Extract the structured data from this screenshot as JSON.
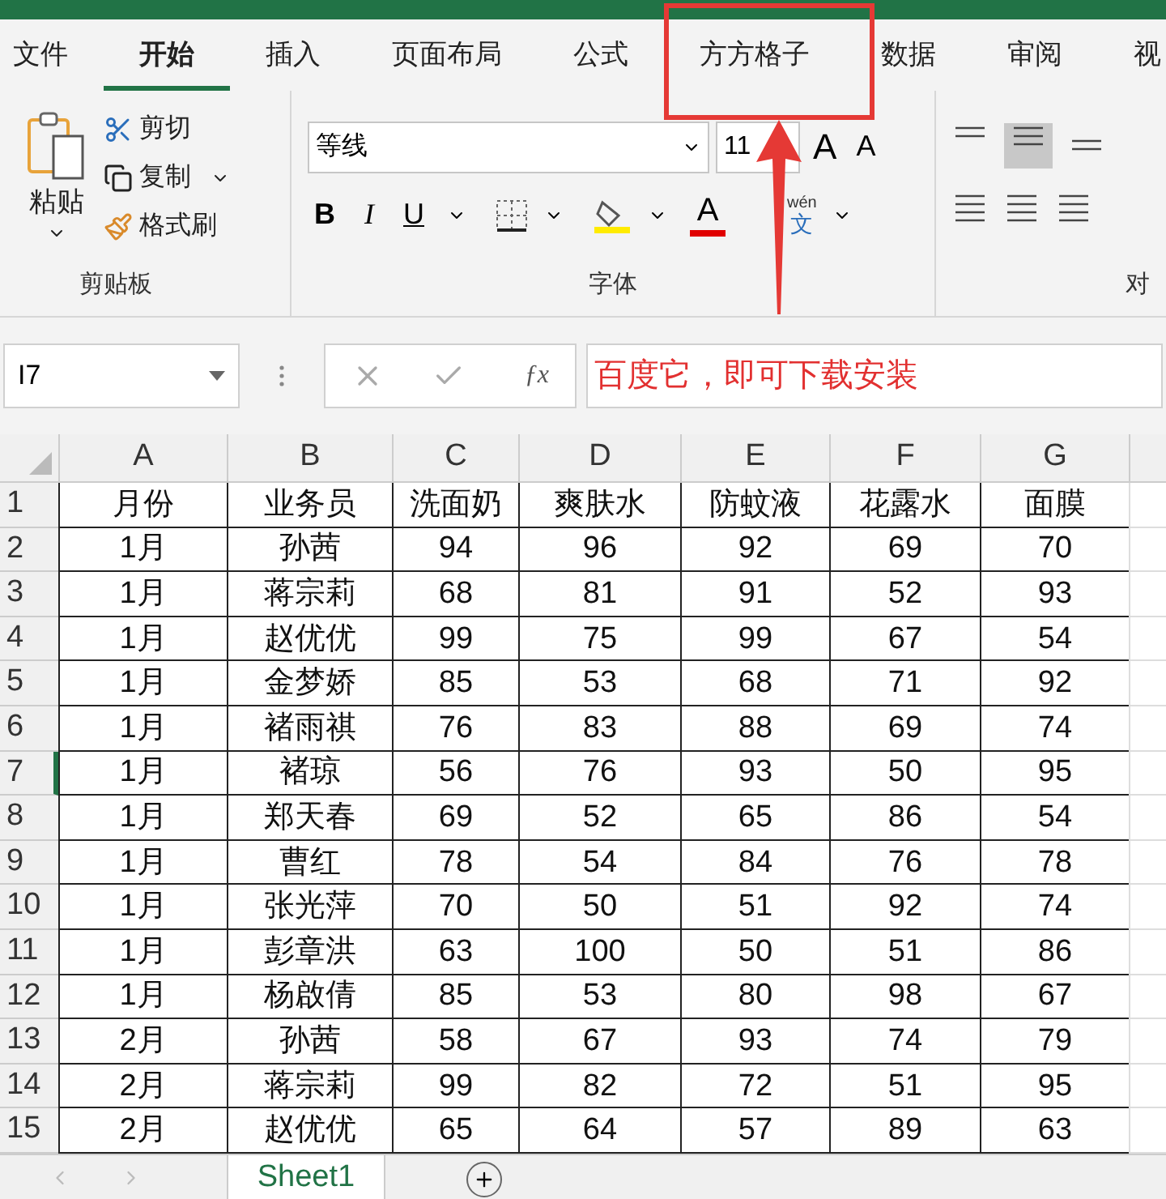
{
  "tabs": [
    {
      "label": "文件",
      "selected": false
    },
    {
      "label": "开始",
      "selected": true
    },
    {
      "label": "插入",
      "selected": false
    },
    {
      "label": "页面布局",
      "selected": false
    },
    {
      "label": "公式",
      "selected": false
    },
    {
      "label": "方方格子",
      "selected": false
    },
    {
      "label": "数据",
      "selected": false
    },
    {
      "label": "审阅",
      "selected": false
    },
    {
      "label": "视",
      "selected": false
    }
  ],
  "clipboard": {
    "paste": "粘贴",
    "cut": "剪切",
    "copy": "复制",
    "painter": "格式刷",
    "label": "剪贴板"
  },
  "font": {
    "name": "等线",
    "size": "11",
    "grow": "A",
    "shrink": "A",
    "bold": "B",
    "italic": "I",
    "underline": "U",
    "font_color": "A",
    "phonetic_top": "wén",
    "phonetic": "文",
    "label": "字体"
  },
  "alignment": {
    "label": "对"
  },
  "name_box": "I7",
  "function_label": "ƒx",
  "formula": "百度它，即可下载安装",
  "columns": [
    "A",
    "B",
    "C",
    "D",
    "E",
    "F",
    "G"
  ],
  "rows": [
    {
      "num": "1",
      "selected": false,
      "cells": [
        "月份",
        "业务员",
        "洗面奶",
        "爽肤水",
        "防蚊液",
        "花露水",
        "面膜"
      ]
    },
    {
      "num": "2",
      "selected": false,
      "cells": [
        "1月",
        "孙茜",
        "94",
        "96",
        "92",
        "69",
        "70"
      ]
    },
    {
      "num": "3",
      "selected": false,
      "cells": [
        "1月",
        "蒋宗莉",
        "68",
        "81",
        "91",
        "52",
        "93"
      ]
    },
    {
      "num": "4",
      "selected": false,
      "cells": [
        "1月",
        "赵优优",
        "99",
        "75",
        "99",
        "67",
        "54"
      ]
    },
    {
      "num": "5",
      "selected": false,
      "cells": [
        "1月",
        "金梦娇",
        "85",
        "53",
        "68",
        "71",
        "92"
      ]
    },
    {
      "num": "6",
      "selected": false,
      "cells": [
        "1月",
        "褚雨祺",
        "76",
        "83",
        "88",
        "69",
        "74"
      ]
    },
    {
      "num": "7",
      "selected": true,
      "cells": [
        "1月",
        "褚琼",
        "56",
        "76",
        "93",
        "50",
        "95"
      ]
    },
    {
      "num": "8",
      "selected": false,
      "cells": [
        "1月",
        "郑天春",
        "69",
        "52",
        "65",
        "86",
        "54"
      ]
    },
    {
      "num": "9",
      "selected": false,
      "cells": [
        "1月",
        "曹红",
        "78",
        "54",
        "84",
        "76",
        "78"
      ]
    },
    {
      "num": "10",
      "selected": false,
      "cells": [
        "1月",
        "张光萍",
        "70",
        "50",
        "51",
        "92",
        "74"
      ]
    },
    {
      "num": "11",
      "selected": false,
      "cells": [
        "1月",
        "彭章洪",
        "63",
        "100",
        "50",
        "51",
        "86"
      ]
    },
    {
      "num": "12",
      "selected": false,
      "cells": [
        "1月",
        "杨啟倩",
        "85",
        "53",
        "80",
        "98",
        "67"
      ]
    },
    {
      "num": "13",
      "selected": false,
      "cells": [
        "2月",
        "孙茜",
        "58",
        "67",
        "93",
        "74",
        "79"
      ]
    },
    {
      "num": "14",
      "selected": false,
      "cells": [
        "2月",
        "蒋宗莉",
        "99",
        "82",
        "72",
        "51",
        "95"
      ]
    },
    {
      "num": "15",
      "selected": false,
      "cells": [
        "2月",
        "赵优优",
        "65",
        "64",
        "57",
        "89",
        "63"
      ]
    }
  ],
  "sheets": [
    {
      "label": "Sheet1",
      "selected": true
    }
  ]
}
